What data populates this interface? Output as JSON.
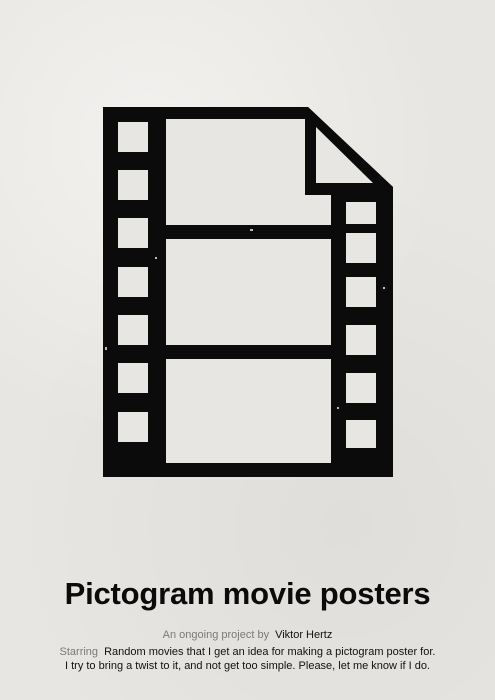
{
  "poster": {
    "pictogram": "film-strip-document-icon",
    "title": "Pictogram movie posters",
    "credit": {
      "label": "An ongoing project by",
      "value": "Viktor Hertz"
    },
    "blurb": {
      "label": "Starring",
      "line1": "Random movies that I get an idea for making a pictogram poster for.",
      "line2": "I try to bring a twist to it, and not get too simple. Please, let me know if I do."
    }
  },
  "colors": {
    "background": "#e8e6e2",
    "ink": "#0b0b0b",
    "label": "#7a7a7a"
  }
}
